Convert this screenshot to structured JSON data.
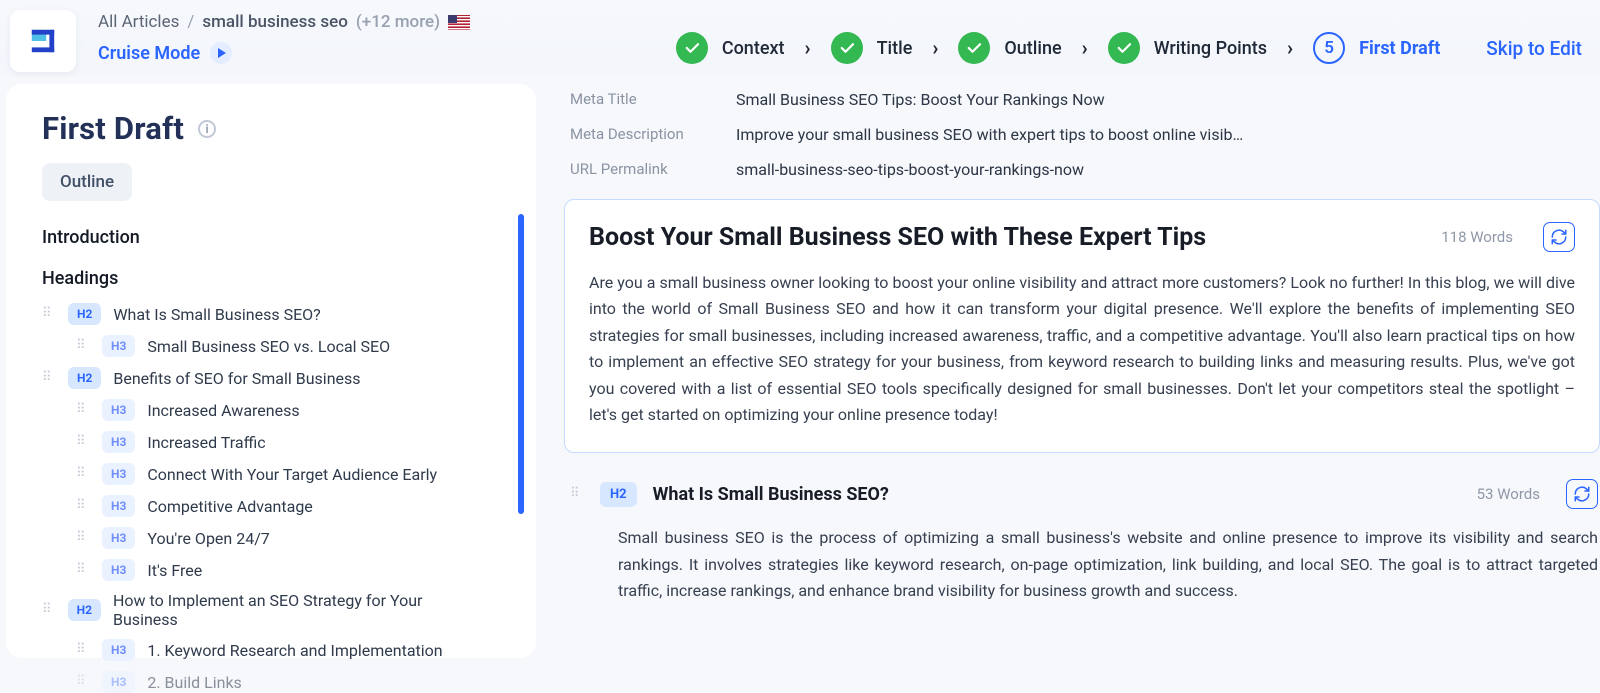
{
  "breadcrumb": {
    "root": "All Articles",
    "sep": "/",
    "keyword": "small business seo",
    "more": "(+12 more)"
  },
  "cruise_label": "Cruise Mode",
  "steps": {
    "s1": "Context",
    "s2": "Title",
    "s3": "Outline",
    "s4": "Writing Points",
    "s5_num": "5",
    "s5": "First Draft"
  },
  "skip_label": "Skip to Edit",
  "sidebar": {
    "title": "First Draft",
    "outline_chip": "Outline",
    "intro": "Introduction",
    "headings_label": "Headings",
    "items": {
      "a": "What Is Small Business SEO?",
      "a1": "Small Business SEO vs. Local SEO",
      "b": "Benefits of SEO for Small Business",
      "b1": "Increased Awareness",
      "b2": "Increased Traffic",
      "b3": "Connect With Your Target Audience Early",
      "b4": "Competitive Advantage",
      "b5": "You're Open 24/7",
      "b6": "It's Free",
      "c": "How to Implement an SEO Strategy for Your Business",
      "c1": "1. Keyword Research and Implementation",
      "c2": "2. Build Links"
    }
  },
  "meta": {
    "title_label": "Meta Title",
    "title_val": "Small Business SEO Tips: Boost Your Rankings Now",
    "desc_label": "Meta Description",
    "desc_val": "Improve your small business SEO with expert tips to boost online visib…",
    "url_label": "URL Permalink",
    "url_val": "small-business-seo-tips-boost-your-rankings-now"
  },
  "card": {
    "title": "Boost Your Small Business SEO with These Expert Tips",
    "words": "118 Words",
    "body": "Are you a small business owner looking to boost your online visibility and attract more customers? Look no further! In this blog, we will dive into the world of Small Business SEO and how it can transform your digital presence. We'll explore the benefits of implementing SEO strategies for small businesses, including increased awareness, traffic, and a competitive advantage. You'll also learn practical tips on how to implement an effective SEO strategy for your business, from keyword research to building links and measuring results. Plus, we've got you covered with a list of essential SEO tools specifically designed for small businesses. Don't let your competitors steal the spotlight – let's get started on optimizing your online presence today!"
  },
  "sub": {
    "tag": "H2",
    "title": "What Is Small Business SEO?",
    "words": "53 Words",
    "body": "Small business SEO is the process of optimizing a small business's website and online presence to improve its visibility and search rankings. It involves strategies like keyword research, on-page optimization, link building, and local SEO. The goal is to attract targeted traffic, increase rankings, and enhance brand visibility for business growth and success."
  },
  "tags": {
    "h2": "H2",
    "h3": "H3"
  }
}
